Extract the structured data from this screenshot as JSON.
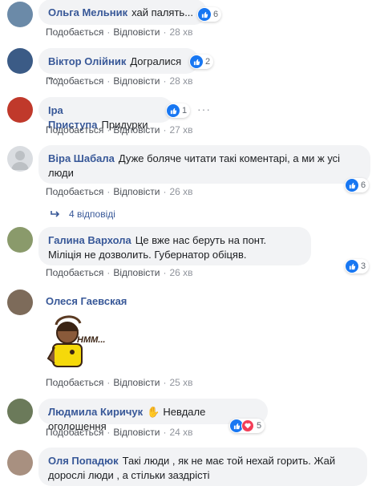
{
  "actions": {
    "like": "Подобається",
    "reply": "Відповісти",
    "sep": "·"
  },
  "comments": [
    {
      "name": "Ольга Мельник",
      "text": "хай палять...",
      "time": "28 хв",
      "reactions": "6"
    },
    {
      "name": "Віктор Олійник",
      "text": "Догралися .....",
      "time": "28 хв",
      "reactions": "2"
    },
    {
      "name": "Іра Приступа",
      "text": "Придурки",
      "time": "27 хв",
      "reactions": "1"
    },
    {
      "name": "Віра Шабала",
      "text": "Дуже боляче читати такі коментарі, а ми ж усі люди",
      "time": "26 хв",
      "reactions": "6",
      "replies": "4 відповіді"
    },
    {
      "name": "Галина Вархола",
      "text": "Це вже нас беруть на понт. Міліція не дозволить. Губернатор обіцяв.",
      "time": "26 хв",
      "reactions": "3"
    },
    {
      "name": "Олеся Гаевская",
      "text": "",
      "time": "25 хв",
      "sticker_text": "HMM..."
    },
    {
      "name": "Людмила Киричук",
      "text": "Невдале оголошення",
      "time": "24 хв",
      "reactions": "5"
    },
    {
      "name": "Оля Попадюк",
      "text": "Такі люди , як не має той нехай горить. Жай дорослі люди , а стільки заздрісті"
    }
  ],
  "colors": {
    "link": "#385898",
    "like": "#1877f2",
    "bubble": "#f2f3f5"
  }
}
